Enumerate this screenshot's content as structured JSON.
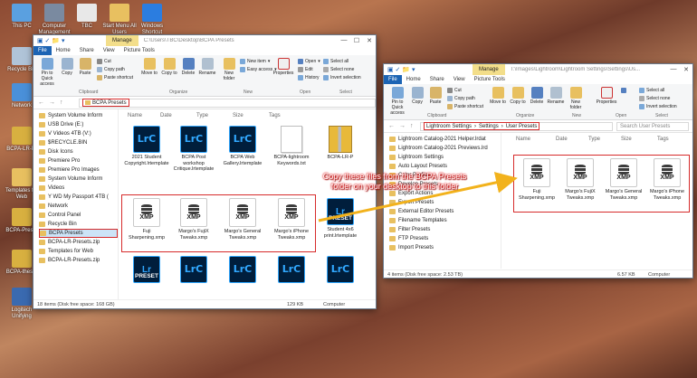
{
  "desktop": {
    "icons": [
      {
        "label": "This PC",
        "color": "#5aa0e0"
      },
      {
        "label": "Computer Management",
        "color": "#7a8aa0"
      },
      {
        "label": "TBC",
        "color": "#e8e8e8"
      },
      {
        "label": "Start Menu All Users",
        "color": "#e8c060"
      },
      {
        "label": "Windows Shortcut",
        "color": "#2b7de0"
      },
      {
        "label": "Recycle Bin",
        "color": "#b0c4d8"
      },
      {
        "label": "Network",
        "color": "#4a90d9"
      },
      {
        "label": "BCPA-LR-Pr",
        "color": "#d8b040"
      },
      {
        "label": "Templates for Web",
        "color": "#e8c060"
      },
      {
        "label": "BCPA-Preset",
        "color": "#d8b040"
      },
      {
        "label": "BCPA-theset",
        "color": "#d8b040"
      },
      {
        "label": "Logitech Unifying",
        "color": "#3a6ab0"
      }
    ]
  },
  "left_window": {
    "manage_tab": "Manage",
    "title_path": "C:\\Users\\TBC\\Desktop\\BCPA Presets",
    "tabs": [
      "File",
      "Home",
      "Share",
      "View",
      "Picture Tools"
    ],
    "ribbon": {
      "pin": "Pin to Quick access",
      "copy": "Copy",
      "paste": "Paste",
      "cut": "Cut",
      "copy_path": "Copy path",
      "paste_shortcut": "Paste shortcut",
      "move_to": "Move to",
      "copy_to": "Copy to",
      "delete": "Delete",
      "rename": "Rename",
      "new_folder": "New folder",
      "new_item": "New item",
      "easy_access": "Easy access",
      "properties": "Properties",
      "open": "Open",
      "edit": "Edit",
      "history": "History",
      "select_all": "Select all",
      "select_none": "Select none",
      "invert_selection": "Invert selection",
      "group_clipboard": "Clipboard",
      "group_organize": "Organize",
      "group_new": "New",
      "group_open": "Open",
      "group_select": "Select"
    },
    "address": "BCPA Presets",
    "columns": [
      "Name",
      "Date",
      "Type",
      "Size",
      "Tags"
    ],
    "nav_items": [
      {
        "label": "System Volume Inform",
        "selected": false
      },
      {
        "label": "USB Drive (E:)",
        "selected": false
      },
      {
        "label": "V Videos 4TB (V:)",
        "selected": false
      },
      {
        "label": "$RECYCLE.BIN",
        "selected": false
      },
      {
        "label": "Disk Icons",
        "selected": false
      },
      {
        "label": "Premiere Pro",
        "selected": false
      },
      {
        "label": "Premiere Pro Images",
        "selected": false
      },
      {
        "label": "System Volume Inform",
        "selected": false
      },
      {
        "label": "Videos",
        "selected": false
      },
      {
        "label": "Y WD My Passport 4TB (",
        "selected": false
      },
      {
        "label": "Network",
        "selected": false
      },
      {
        "label": "Control Panel",
        "selected": false
      },
      {
        "label": "Recycle Bin",
        "selected": false
      },
      {
        "label": "BCPA Presets",
        "selected": true
      },
      {
        "label": "BCPA-LR-Presets.zip",
        "selected": false
      },
      {
        "label": "Templates for Web",
        "selected": false
      },
      {
        "label": "BCPA-LR-Presets.zip",
        "selected": false
      }
    ],
    "files_row1": [
      {
        "name": "2021 Student Copyright.lrtemplate",
        "kind": "lrc"
      },
      {
        "name": "BCPA Post workshop Critique.lrtemplate",
        "kind": "lrc"
      },
      {
        "name": "BCPA Web Gallery.lrtemplate",
        "kind": "lrc"
      },
      {
        "name": "BCPA-lightroom Keywords.txt",
        "kind": "txt"
      },
      {
        "name": "BCPA-LR-P",
        "kind": "zip"
      }
    ],
    "files_row2": [
      {
        "name": "Fuji Sharpening.xmp",
        "kind": "xmp"
      },
      {
        "name": "Margo's FujiX Tweaks.xmp",
        "kind": "xmp"
      },
      {
        "name": "Margo's General Tweaks.xmp",
        "kind": "xmp"
      },
      {
        "name": "Margo's iPhone Tweaks.xmp",
        "kind": "xmp"
      },
      {
        "name": "Student 4x6 print.lrtemplate",
        "kind": "preset"
      }
    ],
    "files_row3": [
      {
        "name": "",
        "kind": "preset"
      },
      {
        "name": "",
        "kind": "lrc"
      },
      {
        "name": "",
        "kind": "lrc"
      },
      {
        "name": "",
        "kind": "lrc"
      },
      {
        "name": "",
        "kind": "lrc"
      }
    ],
    "status_items": "18 items",
    "status_disk": "18 items (Disk free space: 168 GB)",
    "status_size": "129 KB",
    "status_computer": "Computer"
  },
  "right_window": {
    "manage_tab": "Manage",
    "title_path": "T:\\Images\\Lightroom\\Lightroom Settings\\Settings\\Us...",
    "tabs": [
      "File",
      "Home",
      "Share",
      "View",
      "Picture Tools"
    ],
    "breadcrumb": [
      "Lightroom Settings",
      "Settings",
      "User Presets"
    ],
    "search_placeholder": "Search User Presets",
    "columns": [
      "Name",
      "Date",
      "Type",
      "Size",
      "Tags"
    ],
    "nav_items": [
      {
        "label": "Lightroom Catalog-2021 Helper.lrdat"
      },
      {
        "label": "Lightroom Catalog-2021 Previews.lrd"
      },
      {
        "label": "Lightroom Settings"
      },
      {
        "label": "Auto Layout Presets"
      },
      {
        "label": "Color Profiles"
      },
      {
        "label": "Develop Presets"
      },
      {
        "label": "Export Actions"
      },
      {
        "label": "Export Presets"
      },
      {
        "label": "External Editor Presets"
      },
      {
        "label": "Filename Templates"
      },
      {
        "label": "Filter Presets"
      },
      {
        "label": "FTP Presets"
      },
      {
        "label": "Import Presets"
      }
    ],
    "files": [
      {
        "name": "Fuji Sharpening.xmp"
      },
      {
        "name": "Margo's FujiX Tweaks.xmp"
      },
      {
        "name": "Margo's General Tweaks.xmp"
      },
      {
        "name": "Margo's iPhone Tweaks.xmp"
      }
    ],
    "status_disk": "4 items (Disk free space: 2.53 TB)",
    "status_size": "6.57 KB",
    "status_computer": "Computer"
  },
  "annotation": "Copy these files from the BCPA Presets folder on your desktop to this folder",
  "colors": {
    "accent_red": "#d62b2b",
    "arrow": "#f2b21c",
    "manage_tab": "#f3de8a",
    "file_tab": "#1c64b4"
  }
}
